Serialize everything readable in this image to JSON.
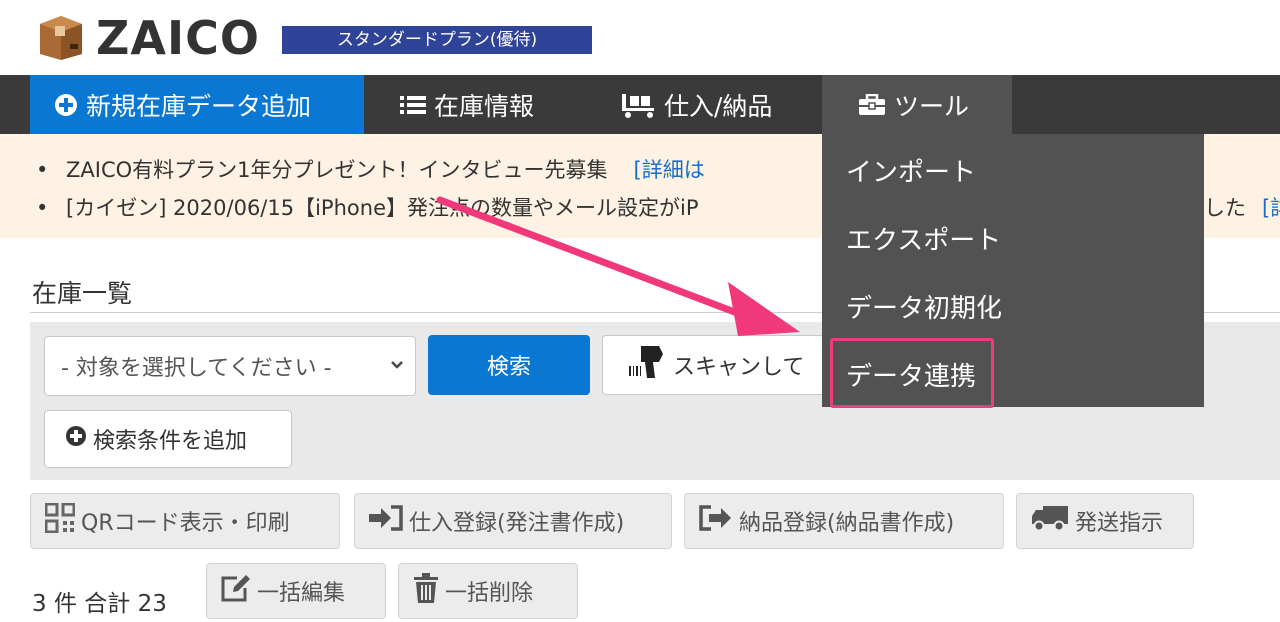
{
  "header": {
    "logo_text": "ZAICO",
    "plan_badge": "スタンダードプラン(優待)"
  },
  "nav": {
    "add_label": "新規在庫データ追加",
    "stock_label": "在庫情報",
    "purchase_label": "仕入/納品",
    "tools_label": "ツール"
  },
  "notices": [
    {
      "text": "ZAICO有料プラン1年分プレゼント！インタビュー先募集",
      "link": "[詳細は"
    },
    {
      "text": "[カイゼン] 2020/06/15【iPhone】発注点の数量やメール設定がiP",
      "tail": "した",
      "link": "[詳"
    }
  ],
  "section": {
    "title": "在庫一覧"
  },
  "search": {
    "select_value": "- 対象を選択してください -",
    "search_label": "検索",
    "scan_label": "スキャンして",
    "add_condition_label": "検索条件を追加"
  },
  "actions": {
    "qr_label": "QRコード表示・印刷",
    "purchase_label": "仕入登録(発注書作成)",
    "delivery_label": "納品登録(納品書作成)",
    "ship_label": "発送指示",
    "edit_label": "一括編集",
    "delete_label": "一括削除"
  },
  "summary": {
    "count_text": "3 件 合計 23"
  },
  "dropdown": {
    "items": [
      "インポート",
      "エクスポート",
      "データ初期化",
      "データ連携"
    ]
  },
  "colors": {
    "nav_bg": "#3a3a3a",
    "primary": "#0a78d2",
    "plan_badge": "#2f4398",
    "dropdown_bg": "#525252",
    "notice_bg": "#fdf2e3",
    "highlight": "#ee3a7e"
  }
}
